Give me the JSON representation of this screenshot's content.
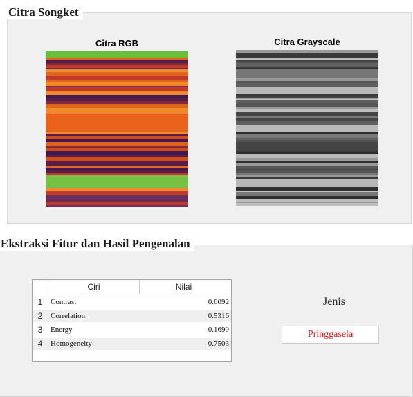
{
  "panels": {
    "top_title": "Citra Songket",
    "bottom_title": "Ekstraksi Fitur dan Hasil Pengenalan"
  },
  "images": {
    "rgb_caption": "Citra RGB",
    "gray_caption": "Citra Grayscale"
  },
  "table": {
    "headers": [
      "Ciri",
      "Nilai"
    ],
    "rows": [
      {
        "index": "1",
        "ciri": "Contrast",
        "nilai": "0.6092"
      },
      {
        "index": "2",
        "ciri": "Correlation",
        "nilai": "0.5316"
      },
      {
        "index": "3",
        "ciri": "Energy",
        "nilai": "0.1690"
      },
      {
        "index": "4",
        "ciri": "Homogeneity",
        "nilai": "0.7503"
      }
    ]
  },
  "result": {
    "label": "Jenis",
    "value": "Pringgasela",
    "value_color": "#e02020"
  }
}
